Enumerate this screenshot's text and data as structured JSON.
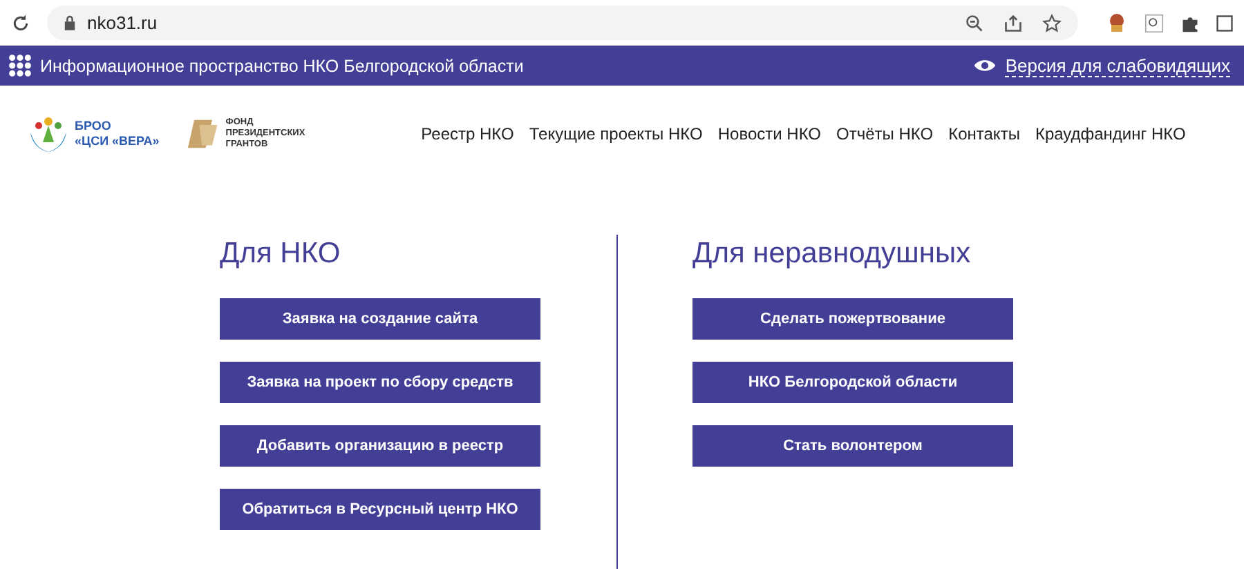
{
  "browser": {
    "url": "nko31.ru"
  },
  "topbar": {
    "title": "Информационное пространство НКО Белгородской области",
    "accessibility_link": "Версия для слабовидящих"
  },
  "logos": {
    "vera": [
      "БРОО",
      "«ЦСИ «ВЕРА»"
    ],
    "fund": [
      "ФОНД",
      "ПРЕЗИДЕНТСКИХ",
      "ГРАНТОВ"
    ]
  },
  "nav": [
    "Реестр НКО",
    "Текущие проекты НКО",
    "Новости НКО",
    "Отчёты НКО",
    "Контакты",
    "Краудфандинг НКО"
  ],
  "columns": [
    {
      "heading": "Для НКО",
      "buttons": [
        "Заявка на создание сайта",
        "Заявка на проект по сбору средств",
        "Добавить организацию в реестр",
        "Обратиться в Ресурсный центр НКО"
      ]
    },
    {
      "heading": "Для неравнодушных",
      "buttons": [
        "Сделать пожертвование",
        "НКО Белгородской области",
        "Стать волонтером"
      ]
    }
  ]
}
